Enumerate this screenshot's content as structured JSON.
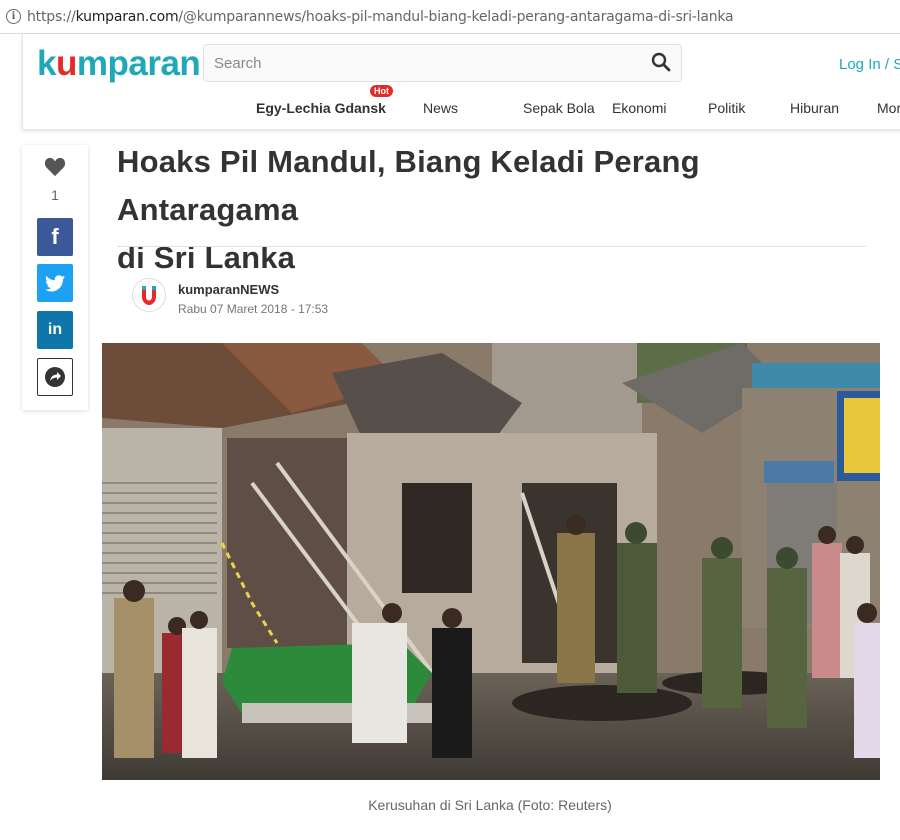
{
  "browser": {
    "url_prefix": "https://",
    "url_domain": "kumparan.com",
    "url_path": "/@kumparannews/hoaks-pil-mandul-biang-keladi-perang-antaragama-di-sri-lanka"
  },
  "header": {
    "logo_k": "k",
    "logo_u": "u",
    "logo_rest": "mparan",
    "search_placeholder": "Search",
    "login": "Log In / S",
    "nav": [
      {
        "label": "Egy-Lechia Gdansk",
        "badge": "Hot"
      },
      {
        "label": "News"
      },
      {
        "label": "Sepak Bola"
      },
      {
        "label": "Ekonomi"
      },
      {
        "label": "Politik"
      },
      {
        "label": "Hiburan"
      },
      {
        "label": "Mor"
      }
    ]
  },
  "sidebar": {
    "like_count": "1",
    "facebook_glyph": "f",
    "linkedin_glyph": "in",
    "icons": [
      "heart-icon",
      "facebook-icon",
      "twitter-icon",
      "linkedin-icon",
      "share-icon"
    ]
  },
  "article": {
    "title_line1": "Hoaks Pil Mandul, Biang Keladi Perang Antaragama",
    "title_line2": "di Sri Lanka",
    "author": "kumparanNEWS",
    "date": "Rabu 07 Maret 2018 - 17:53",
    "caption": "Kerusuhan di Sri Lanka (Foto: Reuters)"
  },
  "colors": {
    "brand": "#1fa8b8",
    "accent": "#e32b2b",
    "facebook": "#3b5998",
    "twitter": "#1da1f2",
    "linkedin": "#0e76a8"
  }
}
